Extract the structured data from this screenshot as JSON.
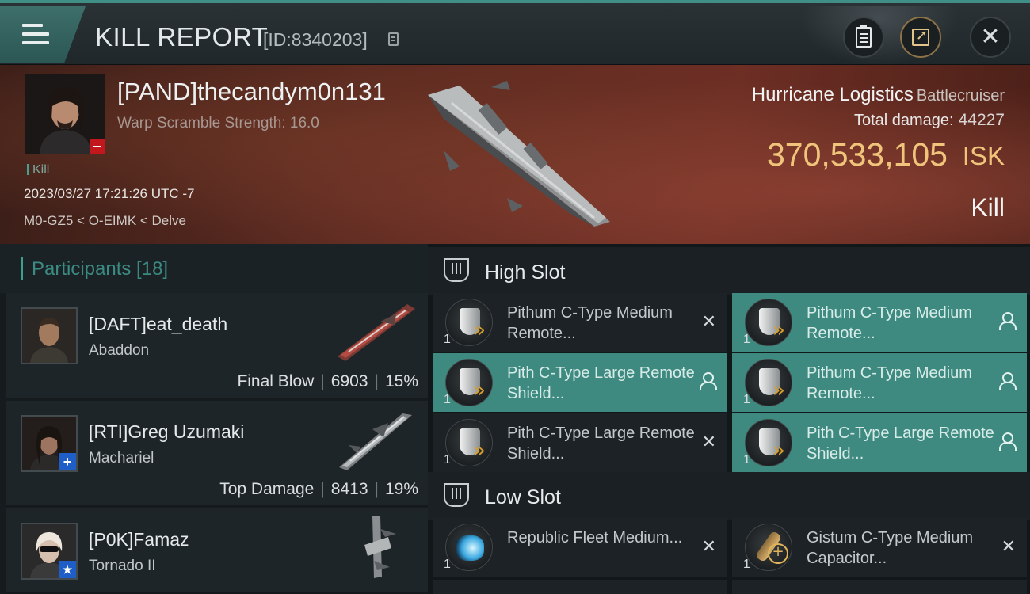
{
  "header": {
    "title": "KILL REPORT",
    "id_label": "[ID:8340203]",
    "icons": [
      "menu-icon",
      "copy-icon",
      "clipboard-icon",
      "export-icon",
      "close-icon"
    ]
  },
  "victim": {
    "name": "[PAND]thecandym0n131",
    "subtitle": "Warp Scramble Strength: 16.0",
    "tag": "Kill",
    "time": "2023/03/27 17:21:26 UTC -7",
    "location": "M0-GZ5 < O-EIMK < Delve",
    "ship_name": "Hurricane Logistics",
    "ship_class": "Battlecruiser",
    "damage_label": "Total damage:",
    "damage_value": "44227",
    "isk_value": "370,533,105",
    "isk_unit": "ISK",
    "result": "Kill"
  },
  "participants": {
    "title": "Participants [18]",
    "rows": [
      {
        "name": "[DAFT]eat_death",
        "ship": "Abaddon",
        "role": "Final Blow",
        "damage": "6903",
        "percent": "15%",
        "badge": ""
      },
      {
        "name": "[RTI]Greg Uzumaki",
        "ship": "Machariel",
        "role": "Top Damage",
        "damage": "8413",
        "percent": "19%",
        "badge": "+"
      },
      {
        "name": "[P0K]Famaz",
        "ship": "Tornado II",
        "badge": "★"
      }
    ]
  },
  "fittings": {
    "high_slot": {
      "title": "High Slot",
      "modules": [
        {
          "qty": "1",
          "name": "Pithum C-Type Medium Remote...",
          "status": "destroyed"
        },
        {
          "qty": "1",
          "name": "Pithum C-Type Medium Remote...",
          "status": "dropped"
        },
        {
          "qty": "1",
          "name": "Pith C-Type Large Remote Shield...",
          "status": "dropped"
        },
        {
          "qty": "1",
          "name": "Pithum C-Type Medium Remote...",
          "status": "dropped"
        },
        {
          "qty": "1",
          "name": "Pith C-Type Large Remote Shield...",
          "status": "destroyed"
        },
        {
          "qty": "1",
          "name": "Pith C-Type Large Remote Shield...",
          "status": "dropped"
        }
      ]
    },
    "low_slot": {
      "title": "Low Slot",
      "modules": [
        {
          "qty": "1",
          "name": "Republic Fleet Medium...",
          "status": "destroyed"
        },
        {
          "qty": "1",
          "name": "Gistum C-Type Medium Capacitor...",
          "status": "destroyed"
        }
      ]
    }
  },
  "colors": {
    "accent": "#3f8a80",
    "isk": "#f0c57b",
    "security_status": "#c2181d"
  }
}
